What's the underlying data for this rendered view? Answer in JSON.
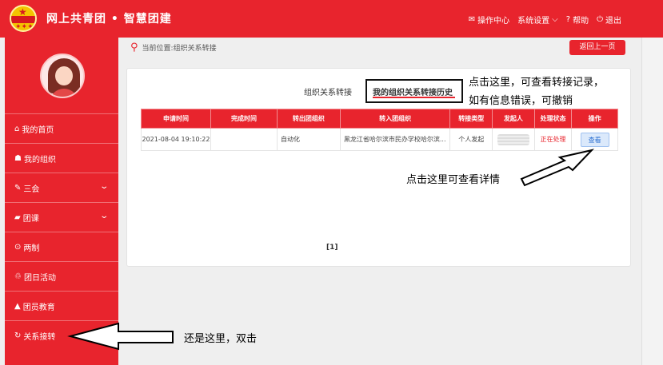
{
  "header": {
    "brand": "网上共青团 • 智慧团建",
    "nav": [
      {
        "icon": "envelope-icon",
        "glyph": "✉",
        "label": "操作中心"
      },
      {
        "icon": "chevron-down-icon",
        "glyph": "⌵",
        "label": "系统设置"
      },
      {
        "icon": "help-icon",
        "glyph": "?",
        "label": "帮助"
      },
      {
        "icon": "power-icon",
        "glyph": "⏻",
        "label": "退出"
      }
    ]
  },
  "sidebar": {
    "items": [
      {
        "icon": "home-icon",
        "glyph": "⌂",
        "label": "我的首页"
      },
      {
        "icon": "users-icon",
        "glyph": "☗",
        "label": "我的组织"
      },
      {
        "icon": "edit-icon",
        "glyph": "✎",
        "label": "三会"
      },
      {
        "icon": "folder-icon",
        "glyph": "▰",
        "label": "团课"
      },
      {
        "icon": "circle-icon",
        "glyph": "⊙",
        "label": "两制"
      },
      {
        "icon": "recycle-icon",
        "glyph": "♲",
        "label": "团日活动"
      },
      {
        "icon": "graduation-icon",
        "glyph": "▲",
        "label": "团员教育"
      },
      {
        "icon": "refresh-icon",
        "glyph": "↻",
        "label": "关系接转"
      }
    ]
  },
  "breadcrumb": "当前位置:组织关系转接",
  "back_button": "返回上一页",
  "tabs": [
    "组织关系转接",
    "我的组织关系转接历史"
  ],
  "table": {
    "headers": [
      "申请时间",
      "完成时间",
      "转出团组织",
      "转入团组织",
      "转接类型",
      "发起人",
      "处理状态",
      "操作"
    ],
    "row": {
      "apply_time": "2021-08-04 19:10:22",
      "finish_time": "",
      "from_org": "自动化",
      "to_org": "黑龙江省哈尔滨市民办学校哈尔滨...",
      "type": "个人发起",
      "status": "正在处理",
      "action": "查看"
    }
  },
  "pager": "[1]",
  "annotations": {
    "top_line1": "点击这里，可查看转接记录，",
    "top_line2": "如有信息错误，可撤销",
    "middle": "点击这里可查看详情",
    "bottom": "还是这里，双击"
  }
}
